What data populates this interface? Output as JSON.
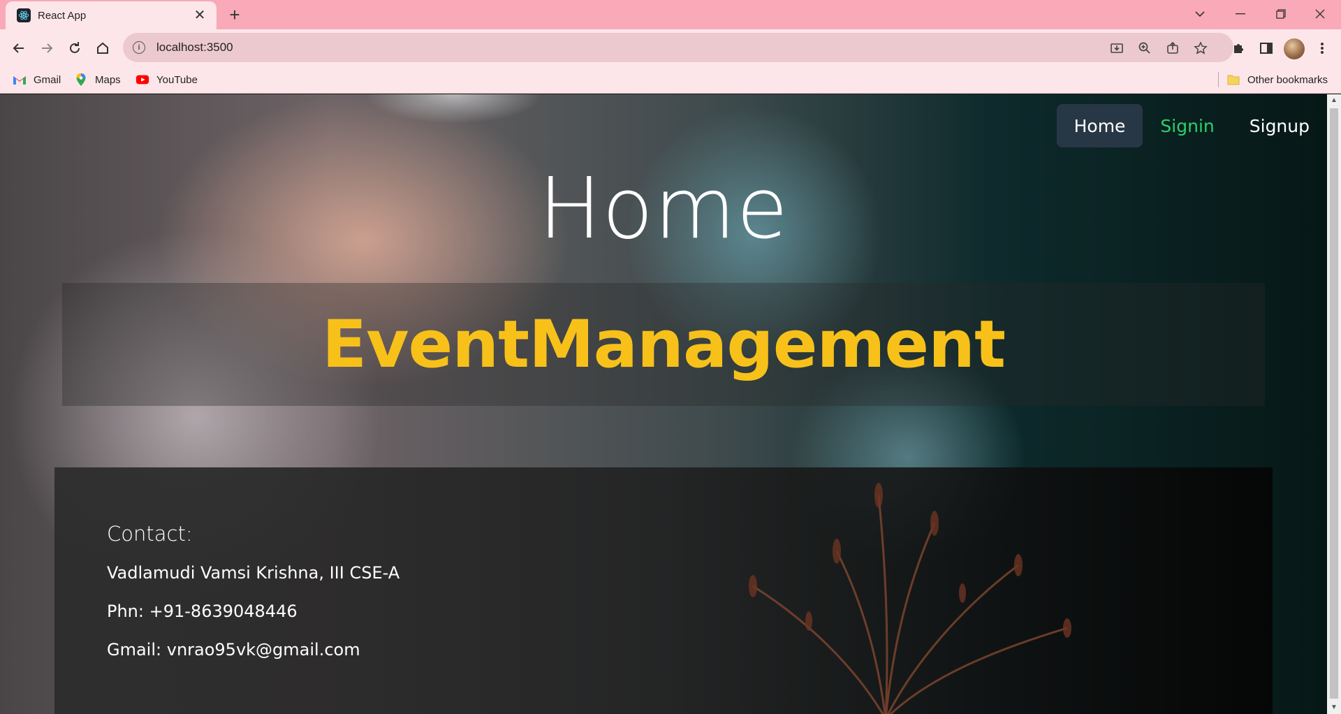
{
  "browser": {
    "tab_title": "React App",
    "url": "localhost:3500",
    "bookmarks": [
      {
        "label": "Gmail",
        "icon": "gmail-icon"
      },
      {
        "label": "Maps",
        "icon": "maps-icon"
      },
      {
        "label": "YouTube",
        "icon": "youtube-icon"
      }
    ],
    "other_bookmarks": "Other bookmarks",
    "colors": {
      "tabbar": "#f9a9b7",
      "toolbar": "#fde6ea",
      "omnibox": "#ecc9cf"
    }
  },
  "page": {
    "nav": {
      "items": [
        {
          "label": "Home",
          "active": true
        },
        {
          "label": "Signin",
          "active": false
        },
        {
          "label": "Signup",
          "active": false
        }
      ]
    },
    "heading": "Home",
    "brand": "EventManagement",
    "contact": {
      "title": "Contact:",
      "name": "Vadlamudi Vamsi Krishna, III CSE-A",
      "phone": "Phn: +91-8639048446",
      "email": "Gmail: vnrao95vk@gmail.com"
    },
    "colors": {
      "brand": "#f7c11a",
      "signin": "#2fcf6a",
      "active_nav_bg": "#283746"
    }
  }
}
